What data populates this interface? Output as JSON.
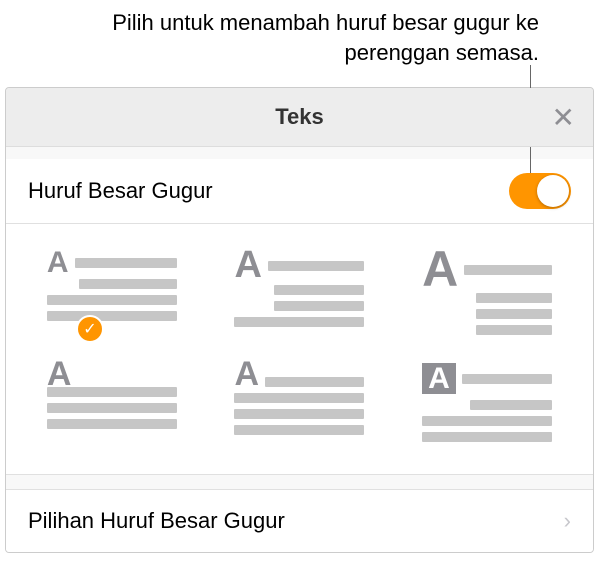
{
  "callout": {
    "text": "Pilih untuk menambah huruf besar gugur ke perenggan semasa."
  },
  "panel": {
    "title": "Teks",
    "close": "✕"
  },
  "toggle": {
    "label": "Huruf Besar Gugur",
    "state": "on"
  },
  "styles": {
    "selected_index": 0,
    "options": [
      {
        "name": "dropcap-style-1"
      },
      {
        "name": "dropcap-style-2"
      },
      {
        "name": "dropcap-style-3"
      },
      {
        "name": "dropcap-style-4"
      },
      {
        "name": "dropcap-style-5"
      },
      {
        "name": "dropcap-style-6"
      }
    ]
  },
  "options_row": {
    "label": "Pilihan Huruf Besar Gugur"
  }
}
